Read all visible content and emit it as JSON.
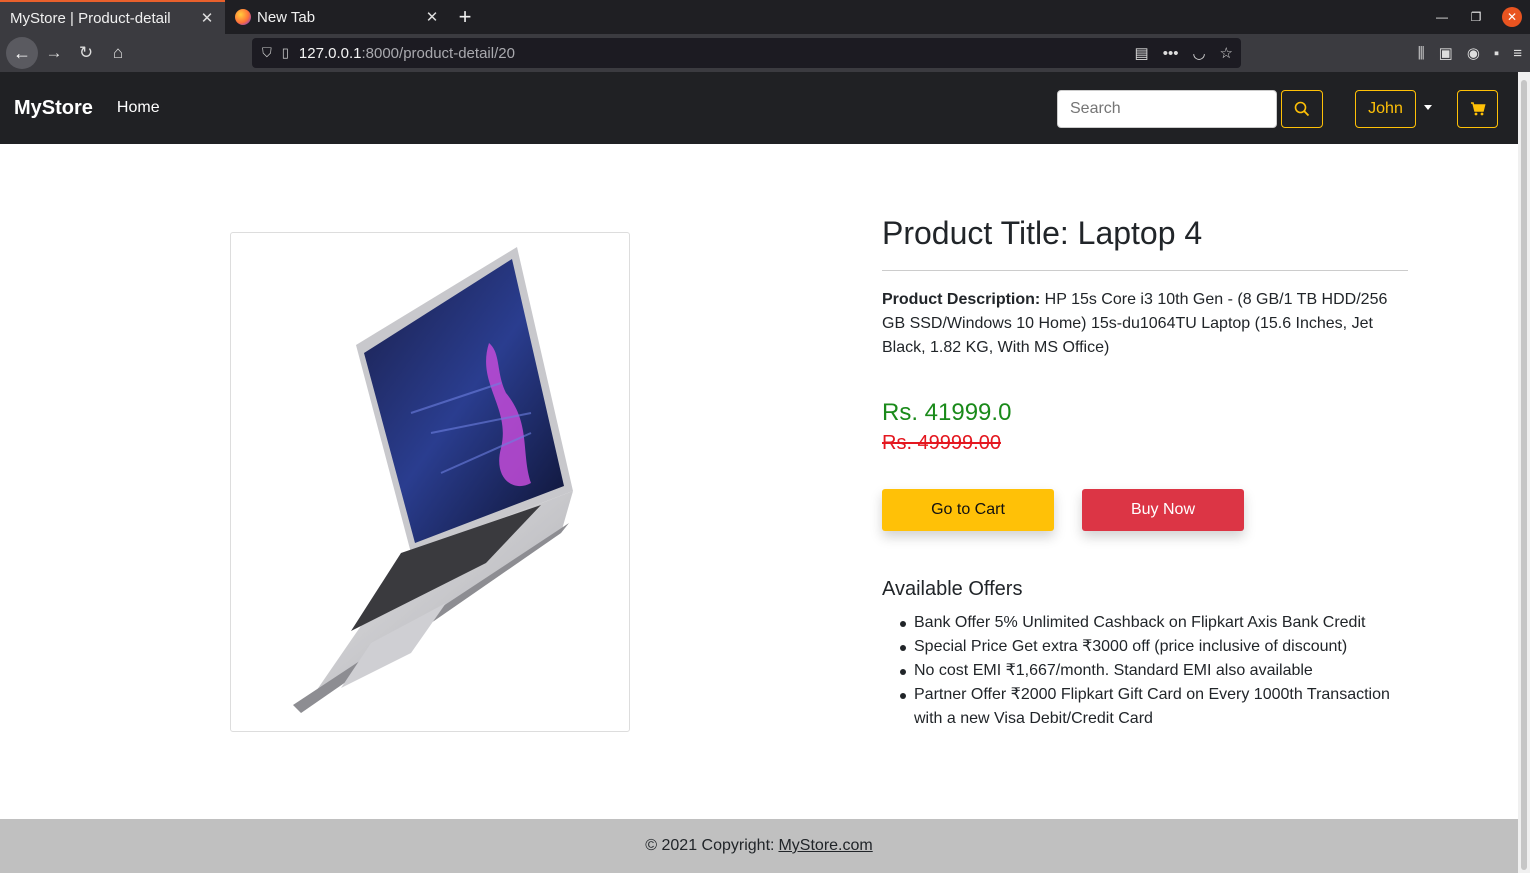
{
  "browser": {
    "tabs": [
      {
        "title": "MyStore | Product-detail",
        "active": true
      },
      {
        "title": "New Tab",
        "active": false
      }
    ],
    "url_host": "127.0.0.1",
    "url_path": ":8000/product-detail/20"
  },
  "navbar": {
    "brand": "MyStore",
    "home_label": "Home",
    "search_placeholder": "Search",
    "user_label": "John",
    "accent_color": "#ffc107"
  },
  "product": {
    "title": "Product Title: Laptop 4",
    "description_label": "Product Description:",
    "description": " HP 15s Core i3 10th Gen - (8 GB/1 TB HDD/256 GB SSD/Windows 10 Home) 15s-du1064TU Laptop (15.6 Inches, Jet Black, 1.82 KG, With MS Office)",
    "price": "Rs. 41999.0",
    "old_price": "Rs. 49999.00",
    "go_to_cart_label": "Go to Cart",
    "buy_now_label": "Buy Now"
  },
  "offers": {
    "title": "Available Offers",
    "items": [
      "Bank Offer 5% Unlimited Cashback on Flipkart Axis Bank Credit",
      "Special Price Get extra ₹3000 off (price inclusive of discount)",
      "No cost EMI ₹1,667/month. Standard EMI also available",
      "Partner Offer ₹2000 Flipkart Gift Card on Every 1000th Transaction with a new Visa Debit/Credit Card"
    ]
  },
  "footer": {
    "text": "© 2021 Copyright:",
    "link": "MyStore.com"
  }
}
